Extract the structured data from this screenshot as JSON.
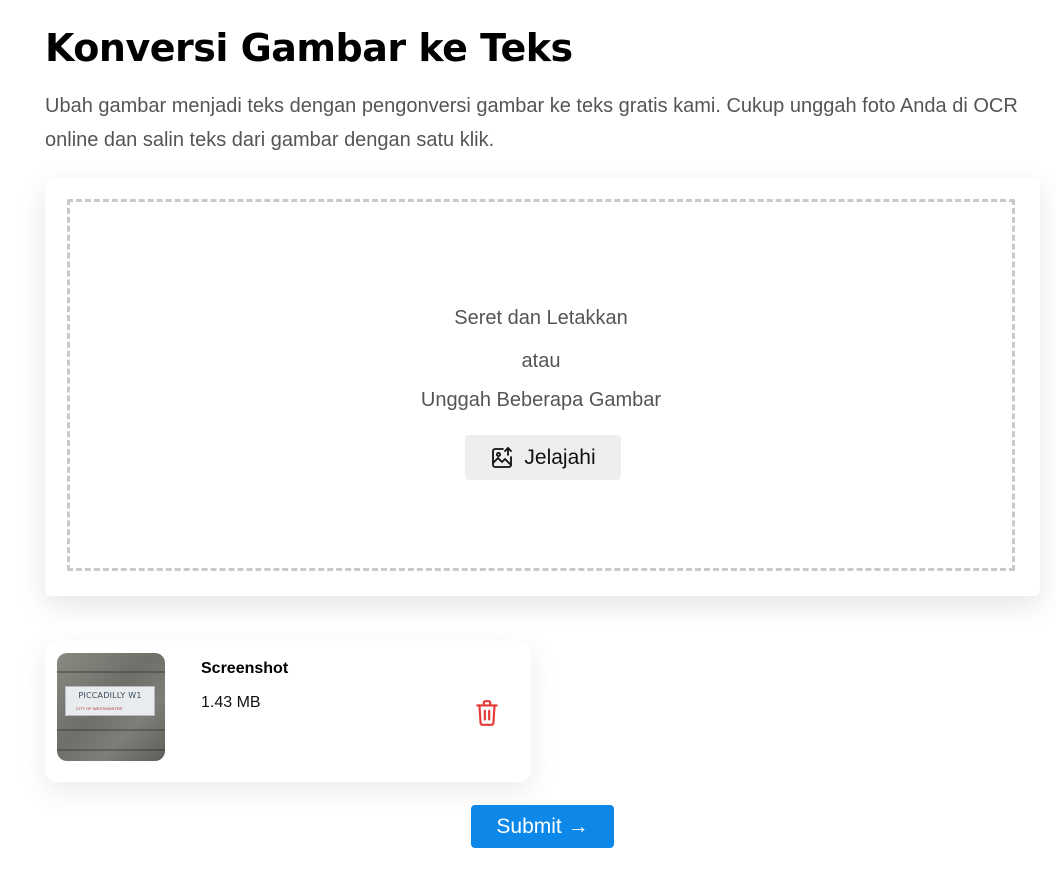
{
  "header": {
    "title": "Konversi Gambar ke Teks",
    "description": "Ubah gambar menjadi teks dengan pengonversi gambar ke teks gratis kami. Cukup unggah foto Anda di OCR online dan salin teks dari gambar dengan satu klik."
  },
  "dropzone": {
    "line1": "Seret dan Letakkan",
    "line2": "atau",
    "line3": "Unggah Beberapa Gambar",
    "browse_label": "Jelajahi",
    "browse_icon": "image-upload-icon"
  },
  "file": {
    "name": "Screenshot",
    "size": "1.43 MB",
    "thumbnail_sign_text": "PICCADILLY W1",
    "thumbnail_sign_subtext": "CITY OF WESTMINSTER",
    "delete_icon": "trash-icon",
    "delete_color": "#e53935"
  },
  "actions": {
    "submit_label": "Submit →",
    "submit_color": "#0d87e8"
  }
}
